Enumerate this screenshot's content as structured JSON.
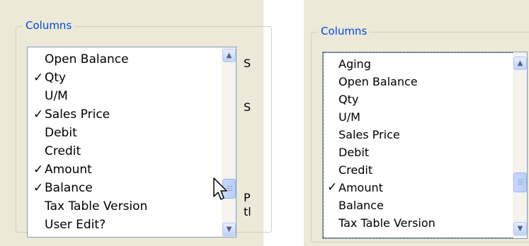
{
  "left": {
    "group_title": "Columns",
    "items": [
      {
        "label": "Open Balance",
        "checked": false
      },
      {
        "label": "Qty",
        "checked": true
      },
      {
        "label": "U/M",
        "checked": false
      },
      {
        "label": "Sales Price",
        "checked": true
      },
      {
        "label": "Debit",
        "checked": false
      },
      {
        "label": "Credit",
        "checked": false
      },
      {
        "label": "Amount",
        "checked": true
      },
      {
        "label": "Balance",
        "checked": true
      },
      {
        "label": "Tax Table Version",
        "checked": false
      },
      {
        "label": "User Edit?",
        "checked": false
      }
    ],
    "side_labels": [
      "S",
      "S",
      "P",
      "tl"
    ]
  },
  "right": {
    "group_title": "Columns",
    "items": [
      {
        "label": "Aging",
        "checked": false
      },
      {
        "label": "Open Balance",
        "checked": false
      },
      {
        "label": "Qty",
        "checked": false
      },
      {
        "label": "U/M",
        "checked": false
      },
      {
        "label": "Sales Price",
        "checked": false
      },
      {
        "label": "Debit",
        "checked": false
      },
      {
        "label": "Credit",
        "checked": false
      },
      {
        "label": "Amount",
        "checked": true
      },
      {
        "label": "Balance",
        "checked": false
      },
      {
        "label": "Tax Table Version",
        "checked": false
      }
    ]
  },
  "check_glyph": "✓",
  "colors": {
    "legend": "#0046d5",
    "panel_bg": "#ece9d8",
    "list_border": "#7f9db9"
  }
}
